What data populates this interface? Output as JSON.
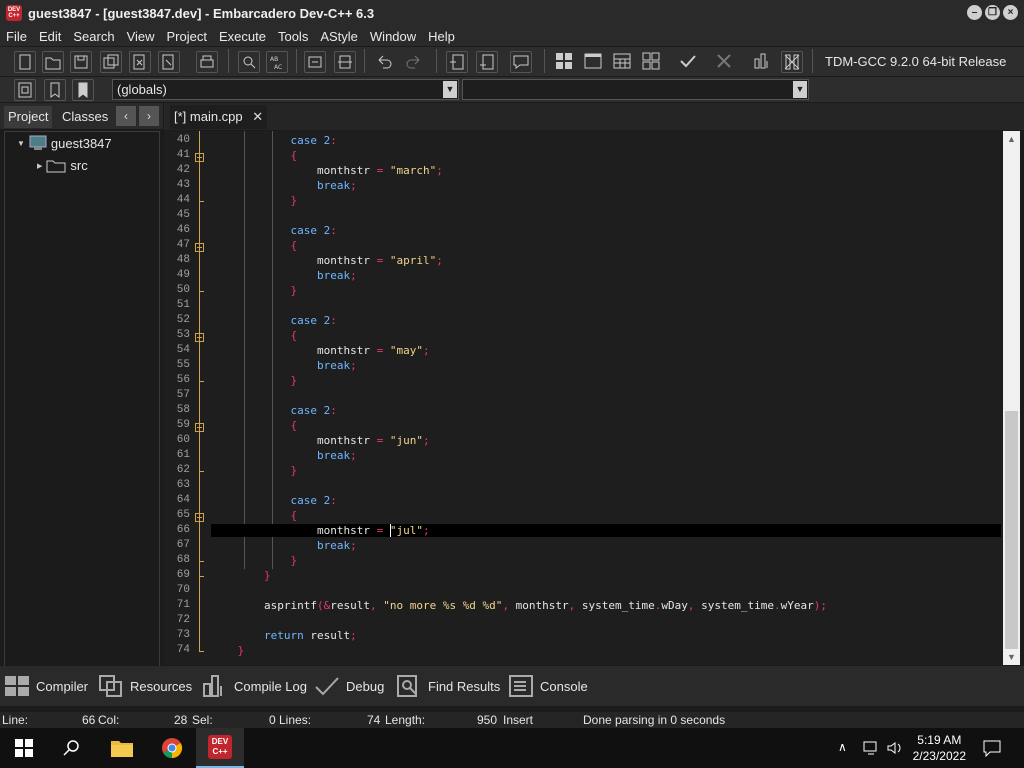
{
  "window": {
    "title": "guest3847 - [guest3847.dev] - Embarcadero Dev-C++ 6.3",
    "app_icon_text": "DEV C++"
  },
  "menu": [
    "File",
    "Edit",
    "Search",
    "View",
    "Project",
    "Execute",
    "Tools",
    "AStyle",
    "Window",
    "Help"
  ],
  "toolbar": {
    "compiler": "TDM-GCC 9.2.0 64-bit Release",
    "scope": "(globals)",
    "icons": [
      "new-file-icon",
      "open-icon",
      "save-icon",
      "save-all-icon",
      "close-icon",
      "close-all-icon",
      "print-icon",
      "find-icon",
      "replace-icon",
      "goto-icon",
      "toggle-icon",
      "undo-icon",
      "redo-icon",
      "indent-icon",
      "unindent-icon",
      "comment-icon",
      "grid-icon",
      "window-icon",
      "layout-icon",
      "modules-icon",
      "compile-icon",
      "stop-icon",
      "chart-icon",
      "clear-icon"
    ]
  },
  "left_panel": {
    "tabs": [
      "Project",
      "Classes"
    ],
    "tree": [
      {
        "label": "guest3847",
        "icon": "project-icon"
      },
      {
        "label": "src",
        "icon": "folder-icon"
      }
    ]
  },
  "editor": {
    "tab_label": "[*] main.cpp",
    "first_line_number": 40,
    "current_line": 66,
    "lines": [
      "            case 2:",
      "            {",
      "                monthstr = \"march\";",
      "                break;",
      "            }",
      "",
      "            case 2:",
      "            {",
      "                monthstr = \"april\";",
      "                break;",
      "            }",
      "",
      "            case 2:",
      "            {",
      "                monthstr = \"may\";",
      "                break;",
      "            }",
      "",
      "            case 2:",
      "            {",
      "                monthstr = \"jun\";",
      "                break;",
      "            }",
      "",
      "            case 2:",
      "            {",
      "                monthstr = \"jul\";",
      "                break;",
      "            }",
      "        }",
      "",
      "        asprintf(&result, \"no more %s %d %d\", monthstr, system_time.wDay, system_time.wYear);",
      "",
      "        return result;",
      "    }"
    ]
  },
  "bottom_tabs": [
    {
      "label": "Compiler",
      "icon": "compiler-icon"
    },
    {
      "label": "Resources",
      "icon": "resources-icon"
    },
    {
      "label": "Compile Log",
      "icon": "compile-log-icon"
    },
    {
      "label": "Debug",
      "icon": "debug-icon"
    },
    {
      "label": "Find Results",
      "icon": "find-results-icon"
    },
    {
      "label": "Console",
      "icon": "console-icon"
    }
  ],
  "status": {
    "line_label": "Line:",
    "line_value": "66",
    "col_label": "Col:",
    "col_value": "28",
    "sel_label": "Sel:",
    "sel_value": "0",
    "lines_label": "Lines:",
    "lines_value": "74",
    "length_label": "Length:",
    "length_value": "950",
    "mode": "Insert",
    "message": "Done parsing in 0 seconds"
  },
  "taskbar": {
    "time": "5:19 AM",
    "date": "2/23/2022"
  },
  "colors": {
    "keyword": "#6fb6ff",
    "string": "#f0d58a",
    "brace": "#e23a69",
    "fold": "#d2a24c"
  }
}
